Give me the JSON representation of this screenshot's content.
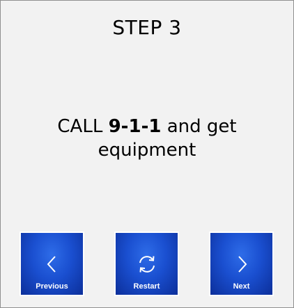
{
  "step_title": "STEP 3",
  "instruction": {
    "before": "CALL ",
    "emphasis": "9-1-1",
    "after": " and get equipment"
  },
  "buttons": {
    "previous": {
      "label": "Previous",
      "icon": "chevron-left-icon"
    },
    "restart": {
      "label": "Restart",
      "icon": "refresh-icon"
    },
    "next": {
      "label": "Next",
      "icon": "chevron-right-icon"
    }
  },
  "colors": {
    "button_blue": "#1a4fd0",
    "panel_background": "#f2f2f2",
    "border": "#8f8f8f"
  }
}
